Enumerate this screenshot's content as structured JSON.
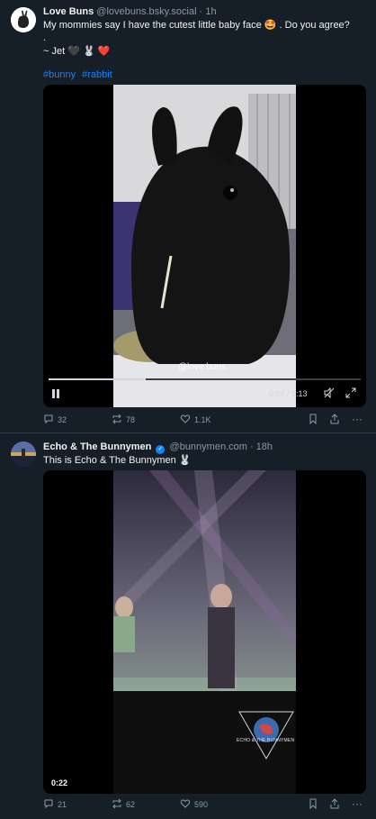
{
  "posts": [
    {
      "author": "Love Buns",
      "handle": "@lovebuns.bsky.social",
      "time": "· 1h",
      "lines": [
        "My mommies say I have the cutest little baby face 🤩 .  Do you agree?",
        ".",
        "~ Jet 🖤 🐰 ❤️"
      ],
      "tags": [
        "#bunny",
        "#rabbit"
      ],
      "video": {
        "watermark": "@love.buns",
        "time_display": "0:04 / 0:13",
        "progress": 0.31
      },
      "stats": {
        "replies": "32",
        "reposts": "78",
        "likes": "1.1K"
      }
    },
    {
      "author": "Echo & The Bunnymen",
      "handle": "@bunnymen.com",
      "time": "· 18h",
      "verified": true,
      "lines": [
        "This is Echo & The Bunnymen 🐰"
      ],
      "video": {
        "duration": "0:22",
        "logo_text": "ECHO & THE BUNNYMEN"
      },
      "stats": {
        "replies": "21",
        "reposts": "62",
        "likes": "590"
      }
    }
  ],
  "colors": {
    "background": "#161e27",
    "accent": "#1083fe",
    "muted": "#8d98a6",
    "text": "#f1f3f5"
  },
  "icons": {
    "reply": "speech-bubble-icon",
    "repost": "repost-arrows-icon",
    "like": "heart-icon",
    "bookmark": "bookmark-icon",
    "share": "share-icon",
    "more": "ellipsis-icon",
    "pause": "pause-icon",
    "mute": "mute-icon",
    "fullscreen": "fullscreen-icon"
  }
}
